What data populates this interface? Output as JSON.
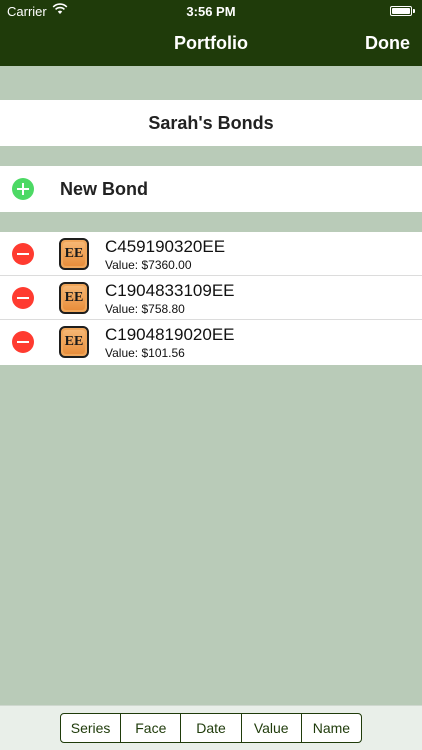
{
  "status_bar": {
    "carrier": "Carrier",
    "time": "3:56 PM",
    "wifi_icon": "wifi-icon",
    "battery_icon": "battery-icon"
  },
  "nav": {
    "title": "Portfolio",
    "done_label": "Done"
  },
  "portfolio": {
    "name": "Sarah's Bonds"
  },
  "new_bond": {
    "label": "New Bond",
    "icon": "add-circle-icon"
  },
  "bonds": [
    {
      "id": "C459190320EE",
      "value": "Value: $7360.00",
      "series": "EE"
    },
    {
      "id": "C1904833109EE",
      "value": "Value: $758.80",
      "series": "EE"
    },
    {
      "id": "C1904819020EE",
      "value": "Value: $101.56",
      "series": "EE"
    }
  ],
  "sort_bar": {
    "segments": [
      "Series",
      "Face",
      "Date",
      "Value",
      "Name"
    ]
  },
  "colors": {
    "nav_background": "#1f3b0a",
    "page_background": "#b9cbb8",
    "add_green": "#4cd964",
    "delete_red": "#ff3b30",
    "ee_badge": "#f0a65a"
  }
}
